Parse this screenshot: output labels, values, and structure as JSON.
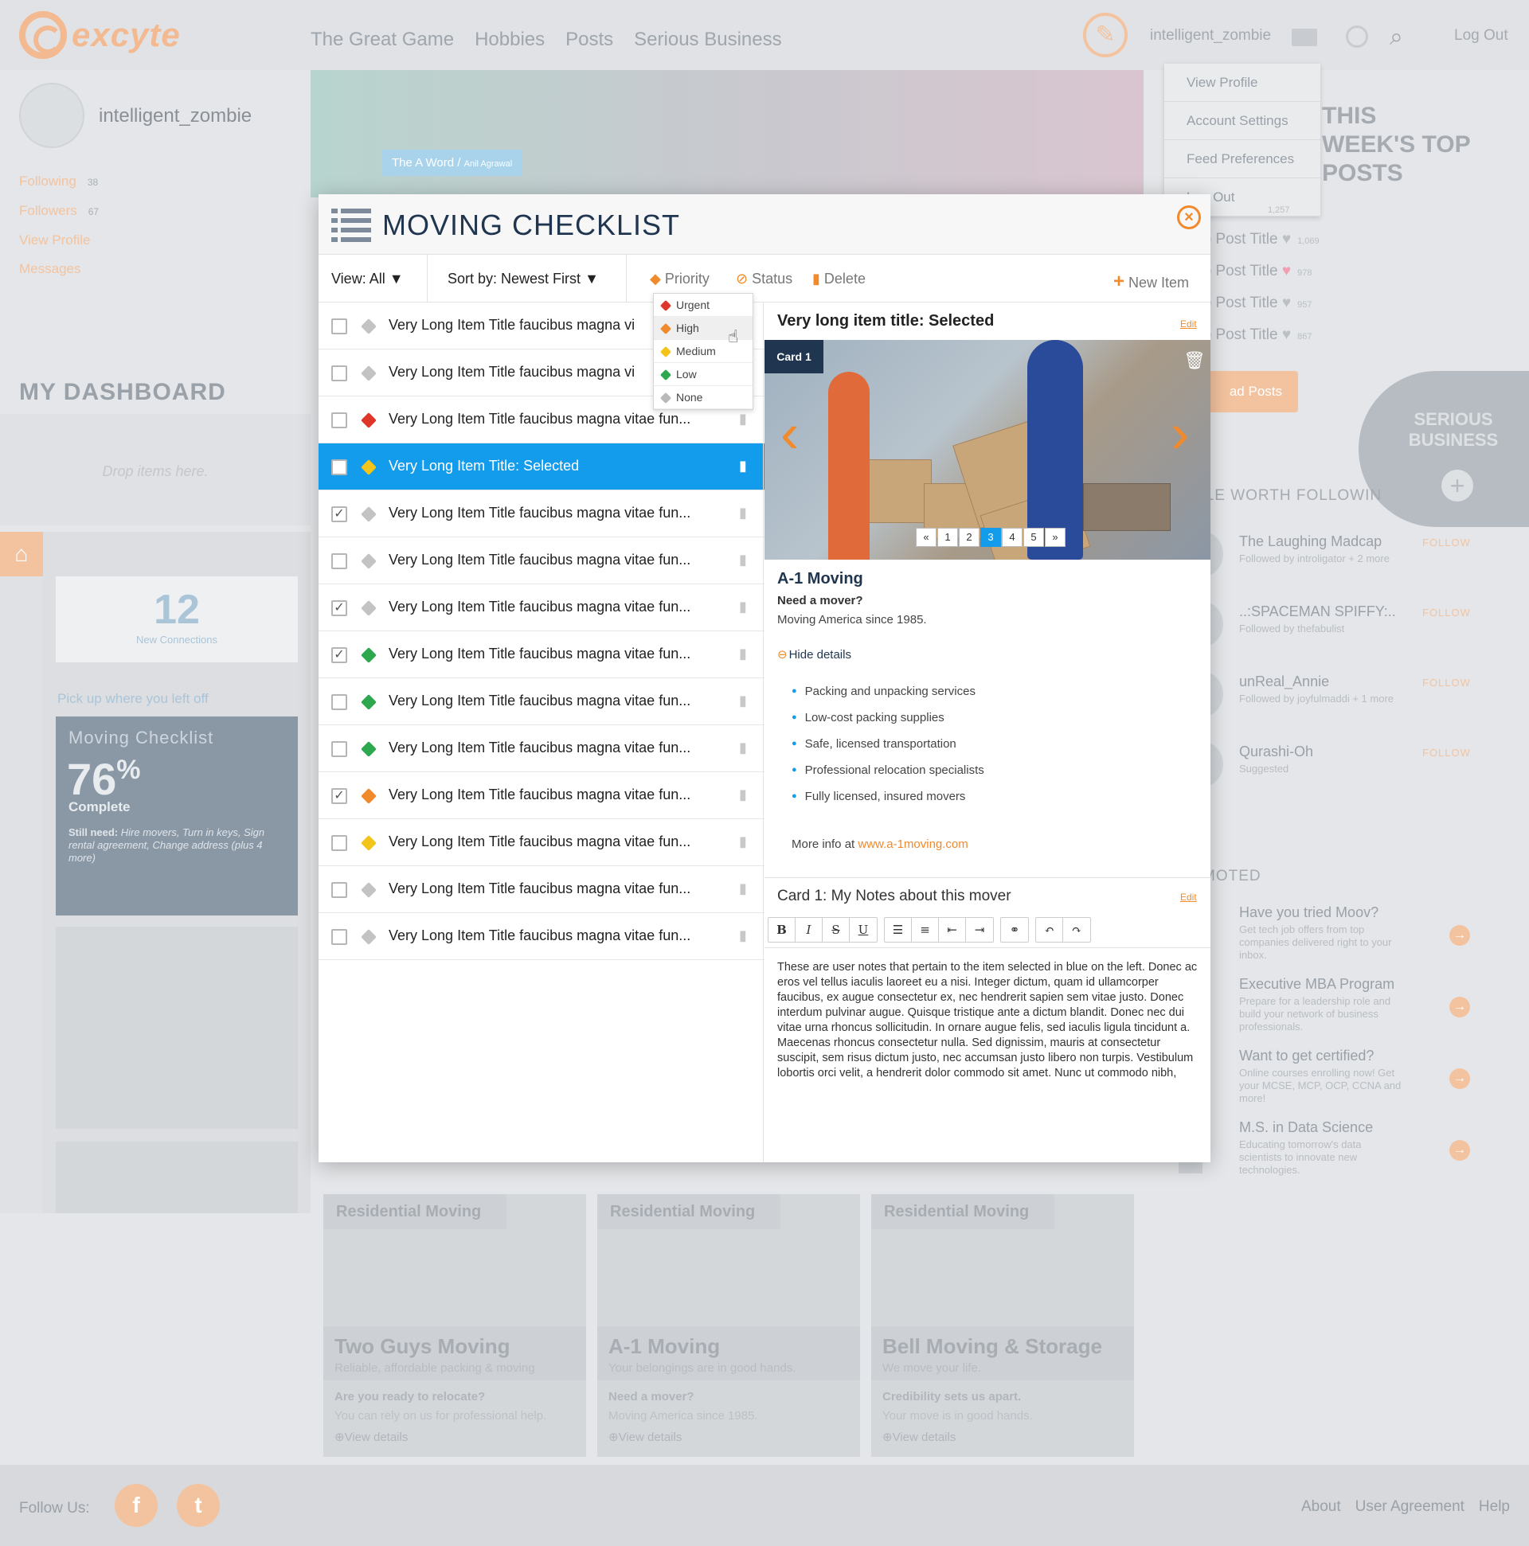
{
  "header": {
    "logo": "excyte",
    "nav": [
      "The Great Game",
      "Hobbies",
      "Posts",
      "Serious Business"
    ],
    "username": "intelligent_zombie",
    "logout": "Log Out"
  },
  "user_menu": [
    "View Profile",
    "Account Settings",
    "Feed Preferences",
    "Log Out"
  ],
  "profile": {
    "name": "intelligent_zombie",
    "following_label": "Following",
    "following_count": "38",
    "followers_label": "Followers",
    "followers_count": "67",
    "view_profile": "View Profile",
    "messages": "Messages"
  },
  "dashboard": {
    "title": "MY DASHBOARD",
    "drop": "Drop items here.",
    "connections_num": "12",
    "connections_label": "New Connections",
    "pick_up": "Pick up where you left off",
    "checklist_title": "Moving Checklist",
    "checklist_pct": "76",
    "checklist_pct_sign": "%",
    "checklist_complete": "Complete",
    "still_need_label": "Still need:",
    "still_need": "Hire movers, Turn in keys, Sign rental agreement, Change address (plus 4 more)"
  },
  "hero": {
    "tag": "The A Word",
    "author": "Anil Agrawal"
  },
  "right": {
    "top_posts": "THIS WEEK'S TOP POSTS",
    "posts": [
      {
        "title": "op Post Title",
        "count": "1,069"
      },
      {
        "title": "op Post Title",
        "count": "978"
      },
      {
        "title": "op Post Title",
        "count": "957"
      },
      {
        "title": "op Post Title",
        "count": "867"
      }
    ],
    "top_count": "1,257",
    "read_posts": "ad Posts",
    "serious": "SERIOUS BUSINESS",
    "worth": "PLE WORTH FOLLOWIN",
    "follow": [
      {
        "name": "The Laughing Madcap",
        "sub": "Followed by introligator + 2 more",
        "btn": "FOLLOW"
      },
      {
        "name": "..:SPACEMAN SPIFFY:..",
        "sub": "Followed by thefabulist",
        "btn": "FOLLOW"
      },
      {
        "name": "unReal_Annie",
        "sub": "Followed by joyfulmaddi + 1 more",
        "btn": "FOLLOW"
      },
      {
        "name": "Qurashi-Oh",
        "sub": "Suggested",
        "btn": "FOLLOW"
      }
    ],
    "promoted": "MOTED",
    "promos": [
      {
        "title": "Have you tried Moov?",
        "desc": "Get tech job offers from top companies delivered right to your inbox."
      },
      {
        "title": "Executive MBA Program",
        "desc": "Prepare for a leadership role and build your network of business professionals."
      },
      {
        "title": "Want to get certified?",
        "desc": "Online courses enrolling now! Get your MCSE, MCP, OCP, CCNA and more!"
      },
      {
        "title": "M.S. in Data Science",
        "desc": "Educating tomorrow's data scientists to innovate new technologies."
      }
    ]
  },
  "cards": [
    {
      "cat": "Residential Moving",
      "name": "Two Guys Moving",
      "tag": "Reliable, affordable packing & moving",
      "q": "Are you ready to relocate?",
      "a": "You can rely on us for professional help.",
      "vd": "View details"
    },
    {
      "cat": "Residential Moving",
      "name": "A-1 Moving",
      "tag": "Your belongings are in good hands.",
      "q": "Need a mover?",
      "a": "Moving America since 1985.",
      "vd": "View details"
    },
    {
      "cat": "Residential Moving",
      "name": "Bell Moving & Storage",
      "tag": "We move your life.",
      "q": "Credibility sets us apart.",
      "a": "Your move is in good hands.",
      "vd": "View details"
    }
  ],
  "footer": {
    "follow_us": "Follow Us:",
    "links": [
      "About",
      "User Agreement",
      "Help"
    ]
  },
  "modal": {
    "title": "MOVING CHECKLIST",
    "view": "View: All",
    "sort": "Sort by: Newest First",
    "priority": "Priority",
    "status": "Status",
    "delete": "Delete",
    "new_item": "New Item",
    "priority_options": [
      {
        "label": "Urgent",
        "color": "#e0352b"
      },
      {
        "label": "High",
        "color": "#f08a2c"
      },
      {
        "label": "Medium",
        "color": "#f3c51a"
      },
      {
        "label": "Low",
        "color": "#2ea84f"
      },
      {
        "label": "None",
        "color": "#b9b9b9"
      }
    ],
    "items": [
      {
        "title": "Very Long Item Title faucibus magna vi",
        "checked": false,
        "tag": "#c3c3c3"
      },
      {
        "title": "Very Long Item Title faucibus magna vi",
        "checked": false,
        "tag": "#c3c3c3"
      },
      {
        "title": "Very Long Item Title faucibus magna vitae fun...",
        "checked": false,
        "tag": "#e0352b"
      },
      {
        "title": "Very Long Item Title: Selected",
        "checked": false,
        "tag": "#f3c51a",
        "selected": true
      },
      {
        "title": "Very Long Item Title faucibus magna vitae fun...",
        "checked": true,
        "tag": "#c3c3c3"
      },
      {
        "title": "Very Long Item Title faucibus magna vitae fun...",
        "checked": false,
        "tag": "#c3c3c3"
      },
      {
        "title": "Very Long Item Title faucibus magna vitae fun...",
        "checked": true,
        "tag": "#c3c3c3"
      },
      {
        "title": "Very Long Item Title faucibus magna vitae fun...",
        "checked": true,
        "tag": "#2ea84f"
      },
      {
        "title": "Very Long Item Title faucibus magna vitae fun...",
        "checked": false,
        "tag": "#2ea84f"
      },
      {
        "title": "Very Long Item Title faucibus magna vitae fun...",
        "checked": false,
        "tag": "#2ea84f"
      },
      {
        "title": "Very Long Item Title faucibus magna vitae fun...",
        "checked": true,
        "tag": "#f08a2c"
      },
      {
        "title": "Very Long Item Title faucibus magna vitae fun...",
        "checked": false,
        "tag": "#f3c51a"
      },
      {
        "title": "Very Long Item Title faucibus magna vitae fun...",
        "checked": false,
        "tag": "#c3c3c3"
      },
      {
        "title": "Very Long Item Title faucibus magna vitae fun...",
        "checked": false,
        "tag": "#c3c3c3"
      }
    ],
    "detail": {
      "title": "Very long item title: Selected",
      "edit": "Edit",
      "card_label": "Card 1",
      "pages": [
        "«",
        "1",
        "2",
        "3",
        "4",
        "5",
        "»"
      ],
      "active_page": "3",
      "company": "A-1 Moving",
      "question": "Need a mover?",
      "answer": "Moving America since 1985.",
      "hide_details": "Hide details",
      "services": [
        "Packing and unpacking services",
        "Low-cost packing supplies",
        "Safe, licensed transportation",
        "Professional relocation specialists",
        "Fully licensed, insured movers"
      ],
      "more_info": "More info at",
      "more_info_link": "www.a-1moving.com",
      "notes_title": "Card 1: My Notes about this mover",
      "notes_edit": "Edit",
      "notes": "These are user notes that pertain to the item selected in blue on the left. Donec ac eros vel tellus iaculis laoreet eu a nisi. Integer dictum, quam id ullamcorper faucibus, ex augue consectetur ex, nec hendrerit sapien sem vitae justo. Donec interdum pulvinar augue. Quisque tristique ante a dictum blandit. Donec nec dui vitae urna rhoncus sollicitudin. In ornare augue felis, sed iaculis ligula tincidunt a. Maecenas rhoncus consectetur nulla. Sed dignissim, mauris at consectetur suscipit, sem risus dictum justo, nec accumsan justo libero non turpis. Vestibulum lobortis orci velit, a hendrerit dolor commodo sit amet. Nunc ut commodo nibh,"
    }
  }
}
